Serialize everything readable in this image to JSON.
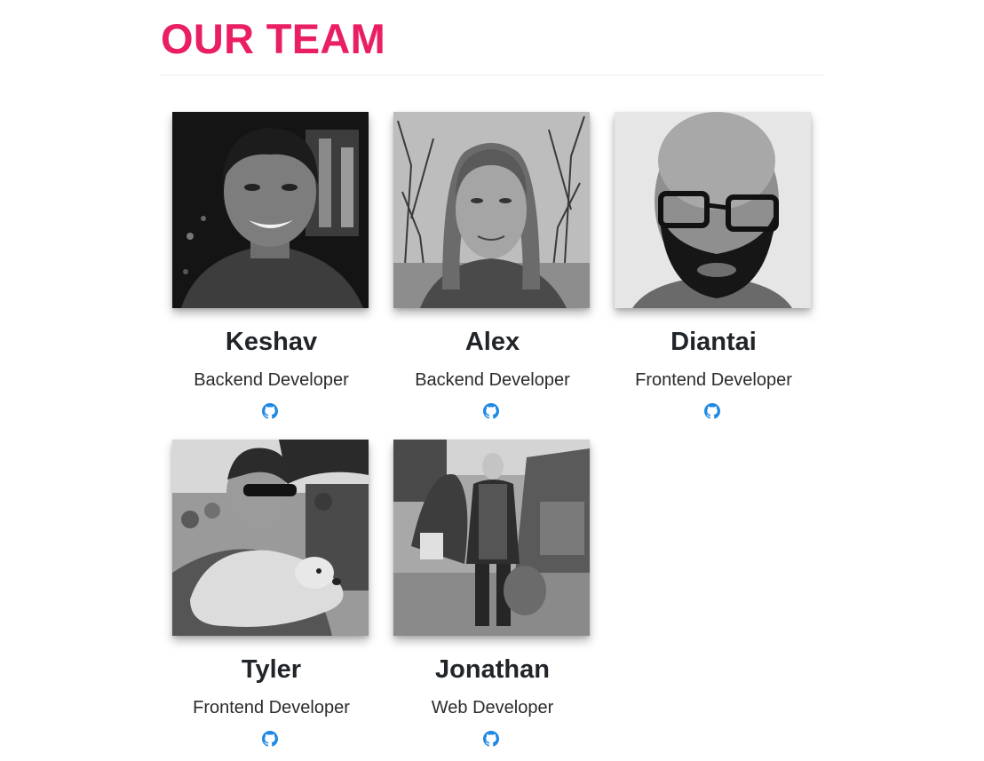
{
  "section": {
    "title": "OUR TEAM",
    "title_color": "#e91e63",
    "link_color": "#1e88e5"
  },
  "members": [
    {
      "name": "Keshav",
      "role": "Backend Developer",
      "icon": "github-icon"
    },
    {
      "name": "Alex",
      "role": "Backend Developer",
      "icon": "github-icon"
    },
    {
      "name": "Diantai",
      "role": "Frontend Developer",
      "icon": "github-icon"
    },
    {
      "name": "Tyler",
      "role": "Frontend Developer",
      "icon": "github-icon"
    },
    {
      "name": "Jonathan",
      "role": "Web Developer",
      "icon": "github-icon"
    }
  ]
}
